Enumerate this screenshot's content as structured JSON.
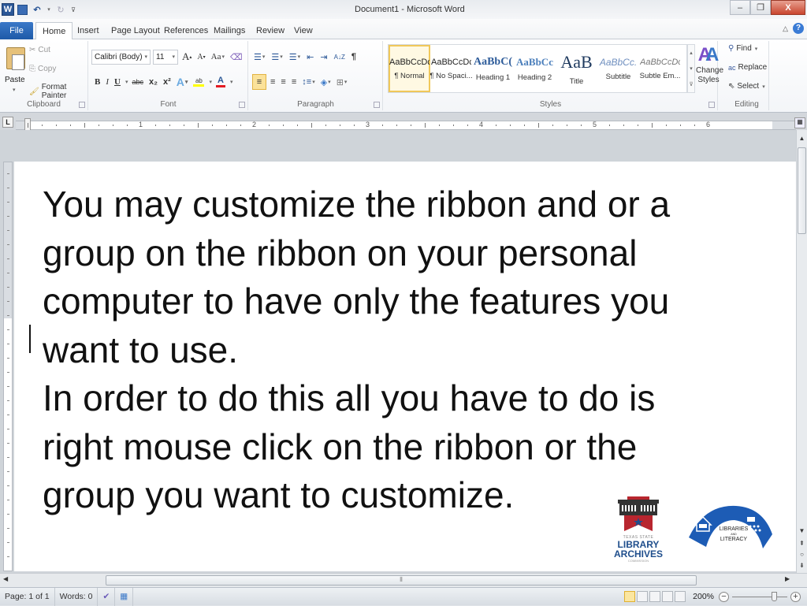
{
  "window": {
    "title": "Document1 - Microsoft Word",
    "app_icon": "word-logo-icon",
    "quick_access": [
      "save-icon",
      "undo-icon",
      "redo-icon",
      "customize-qat-icon"
    ],
    "controls": {
      "minimize": "–",
      "restore": "❐",
      "close": "X"
    }
  },
  "tabs": [
    {
      "label": "File",
      "type": "file"
    },
    {
      "label": "Home",
      "active": true
    },
    {
      "label": "Insert"
    },
    {
      "label": "Page Layout"
    },
    {
      "label": "References"
    },
    {
      "label": "Mailings"
    },
    {
      "label": "Review"
    },
    {
      "label": "View"
    }
  ],
  "tab_right": {
    "minimize_ribbon": "△",
    "help": "?"
  },
  "ribbon": {
    "clipboard": {
      "label": "Clipboard",
      "paste": "Paste",
      "cut": "Cut",
      "copy": "Copy",
      "format_painter": "Format Painter"
    },
    "font": {
      "label": "Font",
      "font_name": "Calibri (Body)",
      "font_size": "11",
      "grow": "A",
      "shrink": "A",
      "change_case": "Aa",
      "bold": "B",
      "italic": "I",
      "underline": "U",
      "strike": "abc",
      "subscript": "x₂",
      "superscript": "x²",
      "text_effects": "A",
      "highlight": "ab",
      "font_color": "A",
      "highlight_color": "#ffff00",
      "font_color_value": "#e31b23"
    },
    "paragraph": {
      "label": "Paragraph",
      "bullets": "☰",
      "numbering": "☰",
      "multilevel": "☰",
      "decrease_indent": "⇤",
      "increase_indent": "⇥",
      "sort": "A↓Z",
      "show_marks": "¶",
      "align_left": "≡",
      "center": "≡",
      "align_right": "≡",
      "justify": "≡",
      "line_spacing": "↕≡",
      "shading": "◈",
      "borders": "⊞"
    },
    "styles": {
      "label": "Styles",
      "items": [
        {
          "preview": "AaBbCcDc",
          "name": "¶ Normal",
          "selected": true,
          "color": "#111111"
        },
        {
          "preview": "AaBbCcDc",
          "name": "¶ No Spaci...",
          "color": "#111111"
        },
        {
          "preview": "AaBbC(",
          "name": "Heading 1",
          "color": "#2e5c9a"
        },
        {
          "preview": "AaBbCc",
          "name": "Heading 2",
          "color": "#4a7ebb"
        },
        {
          "preview": "AaB",
          "name": "Title",
          "color": "#1f3a5f"
        },
        {
          "preview": "AaBbCc.",
          "name": "Subtitle",
          "color": "#6f8fbf"
        },
        {
          "preview": "AaBbCcDc",
          "name": "Subtle Em...",
          "color": "#777777"
        }
      ],
      "change_styles": "Change Styles"
    },
    "editing": {
      "label": "Editing",
      "find": "Find",
      "replace": "Replace",
      "select": "Select"
    }
  },
  "ruler": {
    "numbers": [
      "1",
      "2",
      "3",
      "4",
      "5",
      "6"
    ],
    "tab_selector": "L"
  },
  "document": {
    "text": "You may customize the ribbon and or a\ngroup on the ribbon on your personal\ncomputer to have only the features you\nwant to use.\nIn order to do this all you have to do is\nright mouse click on the ribbon or the\ngroup you want to customize.",
    "logos": {
      "tslac": {
        "line1": "TEXAS STATE",
        "line2": "LIBRARY",
        "line3": "ARCHIVES",
        "line4": "COMMISSION"
      },
      "literacy": {
        "line1": "LIBRARIES",
        "line2": "AND",
        "line3": "LITERACY"
      }
    }
  },
  "status_bar": {
    "page": "Page: 1 of 1",
    "words": "Words: 0",
    "zoom": "200%",
    "zoom_fraction": 0.75
  },
  "colors": {
    "file_tab": "#2a66b8",
    "accent_blue": "#1e5aa8",
    "tslac_red": "#b8262f",
    "tslac_blue": "#1f4e8c",
    "literacy_blue": "#1d5cb5"
  }
}
